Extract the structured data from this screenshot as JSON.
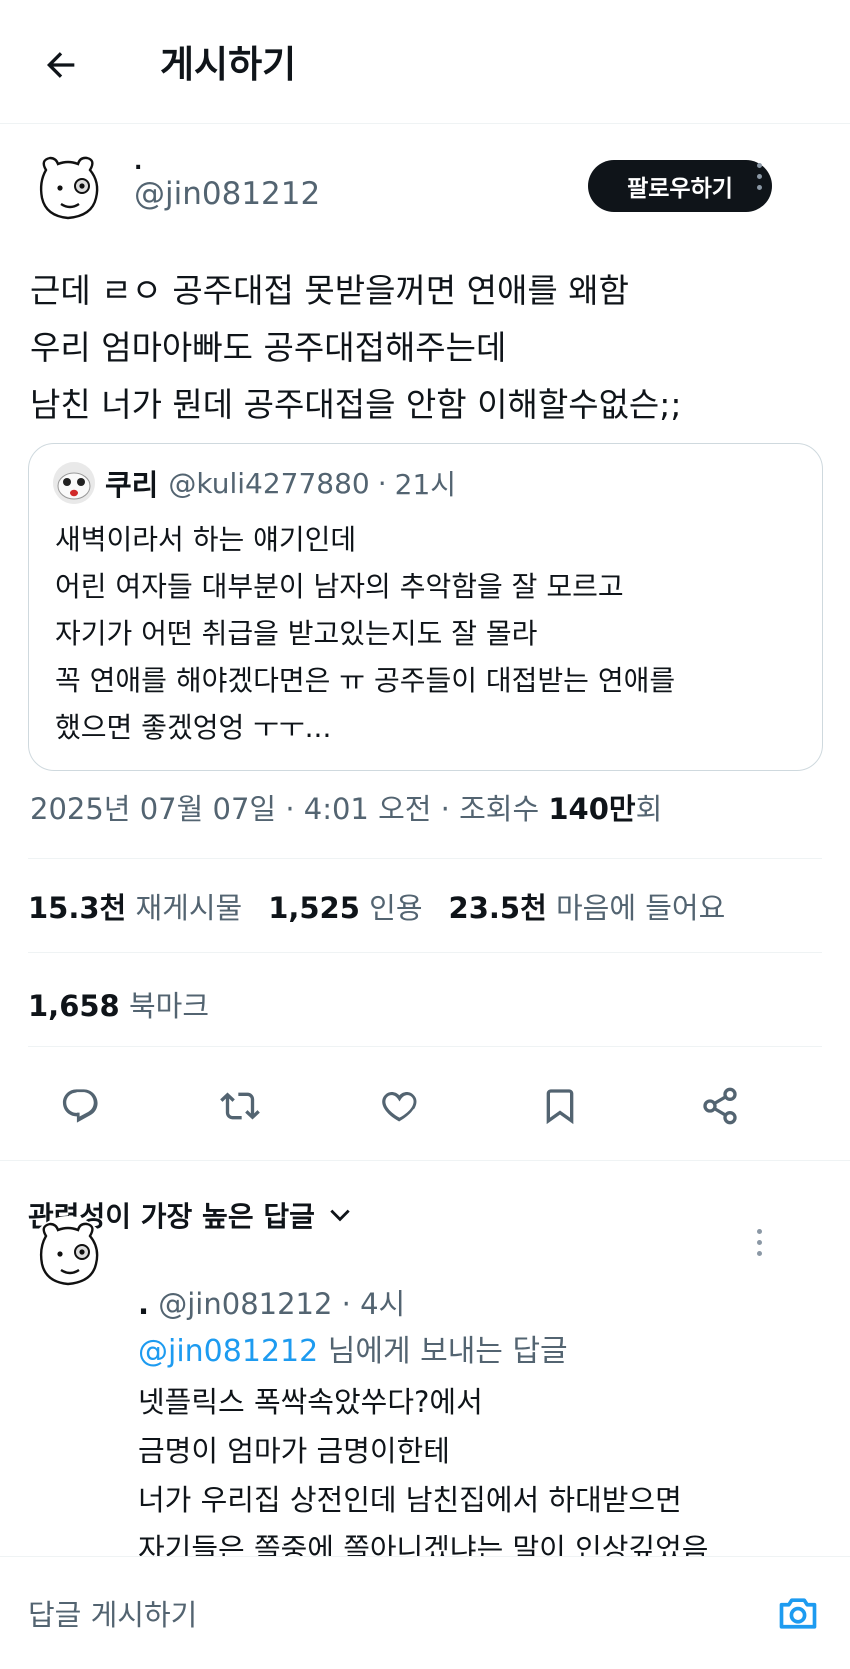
{
  "header": {
    "title": "게시하기"
  },
  "post": {
    "author_name": ".",
    "author_handle": "@jin081212",
    "follow_label": "팔로우하기",
    "text": "근데 ㄹㅇ 공주대접 못받을꺼면 연애를 왜함\n우리 엄마아빠도 공주대접해주는데\n남친 너가 뭔데 공주대접을 안함 이해할수없슨;;",
    "quote": {
      "name": "쿠리",
      "handle": "@kuli4277880",
      "time": "21시",
      "text": "새벽이라서 하는 얘기인데\n어린 여자들 대부분이 남자의 추악함을 잘 모르고\n자기가 어떤 취급을 받고있는지도 잘 몰라\n꼭 연애를 해야겠다면은 ㅠ 공주들이 대접받는 연애를\n했으면 좋겠엉엉 ㅜㅜ..."
    },
    "date": "2025년 07월 07일",
    "time": "4:01 오전",
    "views_label": "조회수",
    "views_value": "140만",
    "views_suffix": "회",
    "separator": "·"
  },
  "stats": {
    "reposts_value": "15.3천",
    "reposts_label": "재게시물",
    "quotes_value": "1,525",
    "quotes_label": "인용",
    "likes_value": "23.5천",
    "likes_label": "마음에 들어요",
    "bookmarks_value": "1,658",
    "bookmarks_label": "북마크"
  },
  "actions": [
    "reply-icon",
    "repost-icon",
    "like-icon",
    "bookmark-icon",
    "share-icon"
  ],
  "replies": {
    "sort_label": "관련성이 가장 높은 답글",
    "items": [
      {
        "name": ".",
        "handle": "@jin081212",
        "time": "4시",
        "reply_to_handle": "@jin081212",
        "reply_to_suffix": "님에게 보내는 답글",
        "text": "넷플릭스 폭싹속았쑤다?에서\n금명이 엄마가 금명이한테\n너가 우리집 상전인데 남친집에서 하대받으면\n자기들은 쫄중에 쫄아니겠냐는 말이 인상깊었음"
      }
    ]
  },
  "composer": {
    "placeholder": "답글 게시하기"
  },
  "colors": {
    "accent": "#1d9bf0",
    "text": "#0f1419",
    "muted": "#536471",
    "border": "#cfd9de",
    "follow_bg": "#0f1419"
  }
}
